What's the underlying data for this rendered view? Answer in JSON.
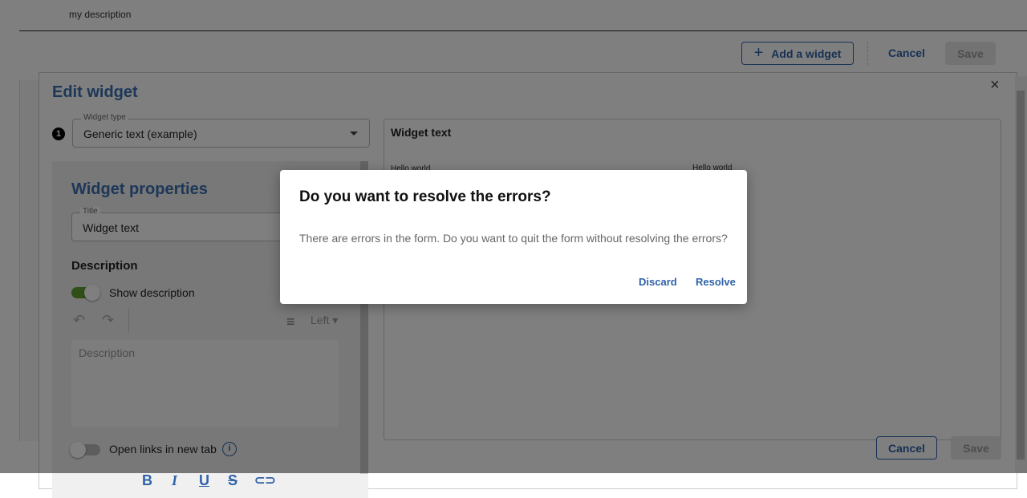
{
  "page": {
    "description": "my description"
  },
  "toolbar": {
    "add_widget_label": "Add a widget",
    "cancel_label": "Cancel",
    "save_label": "Save"
  },
  "edit_widget": {
    "title": "Edit widget",
    "step_number": "1",
    "widget_type_label": "Widget type",
    "widget_type_value": "Generic text (example)",
    "properties_title": "Widget properties",
    "title_label": "Title",
    "title_value": "Widget text",
    "description_heading": "Description",
    "show_description_label": "Show description",
    "show_description_on": true,
    "align_label": "Left",
    "description_placeholder": "Description",
    "open_links_label": "Open links in new tab",
    "open_links_on": false,
    "preview_title": "Widget text",
    "preview_texts": [
      "Hello world",
      "Hello world"
    ],
    "cancel_label": "Cancel",
    "save_label": "Save"
  },
  "dialog": {
    "title": "Do you want to resolve the errors?",
    "message": "There are errors in the form. Do you want to quit the form without resolving the errors?",
    "discard_label": "Discard",
    "resolve_label": "Resolve"
  }
}
